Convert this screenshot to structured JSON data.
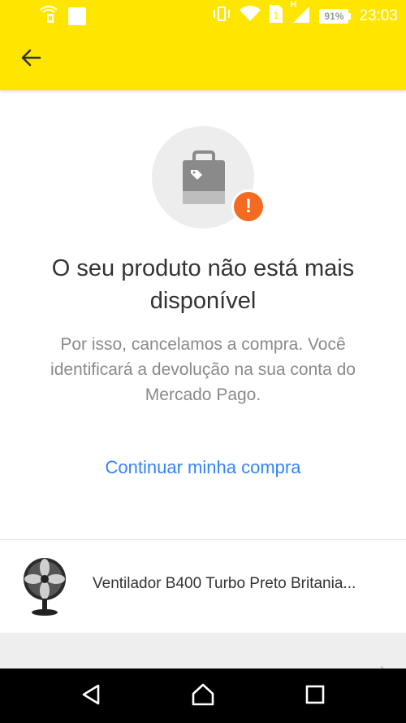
{
  "status_bar": {
    "battery": "91%",
    "time": "23:03",
    "icons": [
      "wifi-calling-icon",
      "notification-square-icon",
      "vibrate-icon",
      "wifi-icon",
      "sim-icon",
      "signal-icon",
      "battery-icon"
    ],
    "network_label": "H"
  },
  "toolbar": {
    "back_icon": "arrow-left-icon",
    "background_color": "#ffe600"
  },
  "main": {
    "illustration_icon": "shopping-bag-icon",
    "alert_icon": "exclamation-icon",
    "alert_glyph": "!",
    "title": "O seu produto não está mais disponível",
    "message": "Por isso, cancelamos a compra. Você identificará a devolução na sua conta do Mercado Pago.",
    "continue_link": "Continuar minha compra"
  },
  "product": {
    "name": "Ventilador B400 Turbo Preto Britania...",
    "thumbnail_icon": "fan-icon"
  },
  "nav": {
    "back_icon": "nav-back-icon",
    "home_icon": "nav-home-icon",
    "recents_icon": "nav-recents-icon"
  },
  "colors": {
    "accent_yellow": "#ffe600",
    "link_blue": "#3483fa",
    "alert_orange": "#f26b21"
  }
}
